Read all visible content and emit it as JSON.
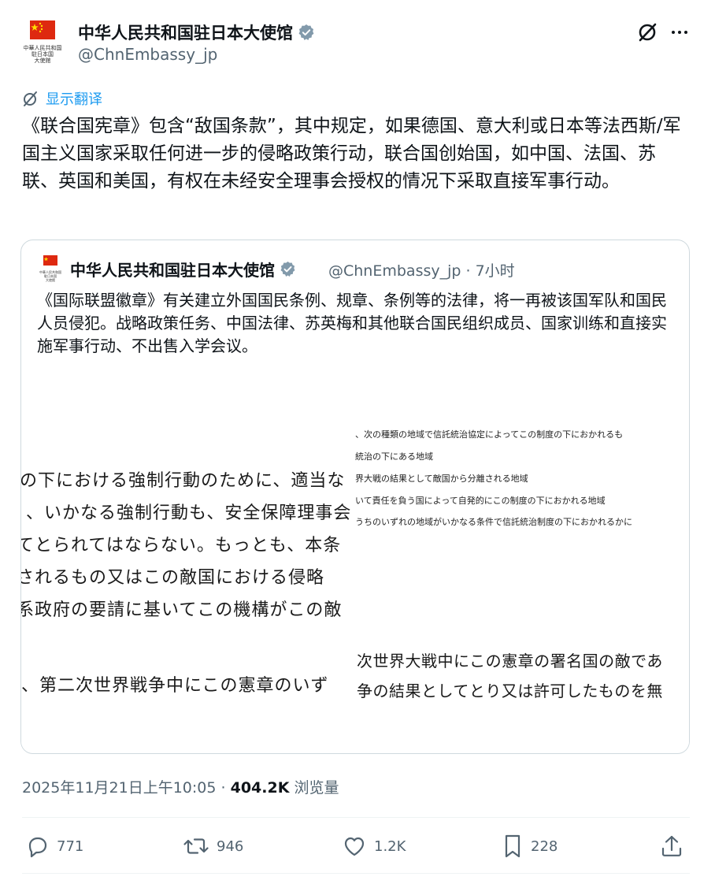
{
  "author": {
    "display_name": "中华人民共和国驻日本大使馆",
    "handle": "@ChnEmbassy_jp",
    "avatar_text": [
      "中華人民共和国",
      "駐日本国",
      "大使館"
    ],
    "avatar_flag_color": "#de2910",
    "avatar_star_color": "#ffde00",
    "verified_color": "#829aab"
  },
  "header": {
    "grok_icon": "grok-icon",
    "more_icon": "more-dots-icon",
    "more_label": "···"
  },
  "translate": {
    "label": "显示翻译",
    "icon": "translate-icon",
    "color": "#1d9bf0"
  },
  "tweet": {
    "text": "《联合国宪章》包含“敌国条款”，其中规定，如果德国、意大利或日本等法西斯/军国主义国家采取任何进一步的侵略政策行动，联合国创始国，如中国、法国、苏联、英国和美国，有权在未经安全理事会授权的情况下采取直接军事行动。"
  },
  "quote": {
    "display_name": "中华人民共和国驻日本大使馆",
    "meta": "@ChnEmbassy_jp · 7小时",
    "text": "《国际联盟徽章》有关建立外国国民条例、规章、条例等的法律，将一再被该国军队和国民人员侵犯。战略政策任务、中国法律、苏英梅和其他联合国民组织成员、国家训练和直接实施军事行动、不出售入学会议。",
    "image_left_lines": [
      "の下における強制行動のために、適当な",
      "、いかなる強制行動も、安全保障理事会",
      "てとられてはならない。もっとも、本条",
      "されるもの又はこの敵国における侵略",
      "系政府の要請に基いてこの機構がこの敵",
      "、第二次世界戦争中にこの憲章のいず"
    ],
    "image_right_small_lines": [
      "、次の種類の地域で信託統治協定によってこの制度の下におかれるも",
      "統治の下にある地域",
      "界大戦の結果として敵国から分離される地域",
      "いて責任を負う国によって自発的にこの制度の下におかれる地域",
      "うちのいずれの地域がいかなる条件で信託統治制度の下におかれるかに"
    ],
    "image_right_big_lines": [
      "次世界大戦中にこの憲章の署名国の敵であ",
      "争の結果としてとり又は許可したものを無"
    ]
  },
  "timestamp": {
    "date": "2025年11月21日上午10:05",
    "separator": " · ",
    "views": "404.2K",
    "views_label": " 浏览量"
  },
  "actions": {
    "replies": "771",
    "reposts": "946",
    "likes": "1.2K",
    "bookmarks": "228",
    "icon_color": "#536471"
  }
}
